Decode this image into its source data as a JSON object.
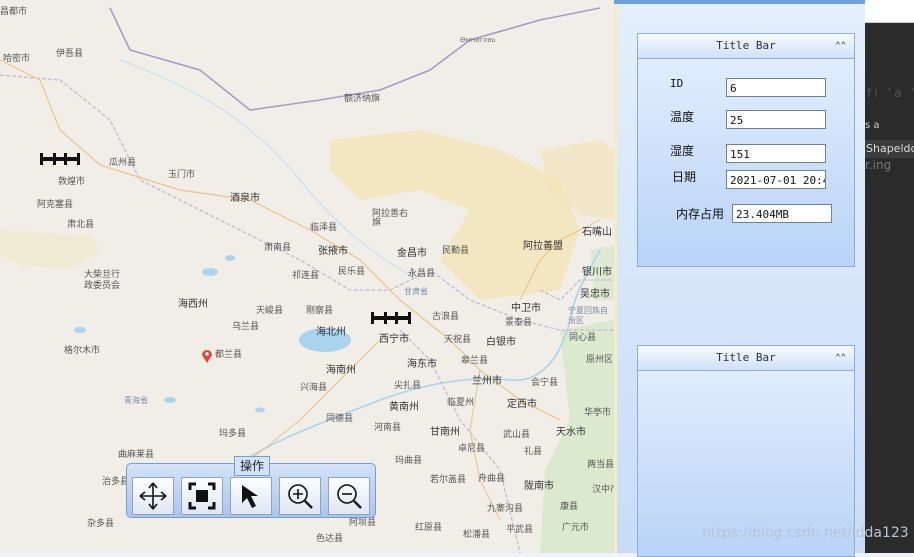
{
  "map": {
    "places": [
      {
        "id": "p01",
        "text": "哈密市",
        "cls": ""
      },
      {
        "id": "p02",
        "text": "伊吾县",
        "cls": ""
      },
      {
        "id": "p03",
        "text": "额济纳旗",
        "cls": ""
      },
      {
        "id": "p04",
        "text": "瓜州县",
        "cls": ""
      },
      {
        "id": "p05",
        "text": "玉门市",
        "cls": ""
      },
      {
        "id": "p06",
        "text": "敦煌市",
        "cls": ""
      },
      {
        "id": "p07",
        "text": "阿克塞县",
        "cls": ""
      },
      {
        "id": "p08",
        "text": "肃北县",
        "cls": ""
      },
      {
        "id": "p09",
        "text": "酒泉市",
        "cls": "big"
      },
      {
        "id": "p10",
        "text": "临泽县",
        "cls": ""
      },
      {
        "id": "p11",
        "text": "阿拉善右旗",
        "cls": ""
      },
      {
        "id": "p12",
        "text": "肃南县",
        "cls": ""
      },
      {
        "id": "p13",
        "text": "张掖市",
        "cls": "big"
      },
      {
        "id": "p14",
        "text": "金昌市",
        "cls": "big"
      },
      {
        "id": "p15",
        "text": "民勤县",
        "cls": ""
      },
      {
        "id": "p16",
        "text": "阿拉善盟",
        "cls": "big"
      },
      {
        "id": "p17",
        "text": "石嘴山",
        "cls": "big"
      },
      {
        "id": "p18",
        "text": "大柴旦行政委员会",
        "cls": ""
      },
      {
        "id": "p19",
        "text": "祁连县",
        "cls": ""
      },
      {
        "id": "p20",
        "text": "民乐县",
        "cls": ""
      },
      {
        "id": "p21",
        "text": "永昌县",
        "cls": ""
      },
      {
        "id": "p22",
        "text": "银川市",
        "cls": "big"
      },
      {
        "id": "p23",
        "text": "甘肃省",
        "cls": "prov"
      },
      {
        "id": "p24",
        "text": "吴忠市",
        "cls": "big"
      },
      {
        "id": "p25",
        "text": "海西州",
        "cls": "big"
      },
      {
        "id": "p26",
        "text": "天峻县",
        "cls": ""
      },
      {
        "id": "p27",
        "text": "刚察县",
        "cls": ""
      },
      {
        "id": "p28",
        "text": "中卫市",
        "cls": "big"
      },
      {
        "id": "p29",
        "text": "景泰县",
        "cls": ""
      },
      {
        "id": "p30",
        "text": "宁夏回族自治区",
        "cls": "prov"
      },
      {
        "id": "p31",
        "text": "乌兰县",
        "cls": ""
      },
      {
        "id": "p32",
        "text": "海北州",
        "cls": "big"
      },
      {
        "id": "p33",
        "text": "古浪县",
        "cls": ""
      },
      {
        "id": "p34",
        "text": "天祝县",
        "cls": ""
      },
      {
        "id": "p35",
        "text": "白银市",
        "cls": "big"
      },
      {
        "id": "p36",
        "text": "同心县",
        "cls": ""
      },
      {
        "id": "p37",
        "text": "格尔木市",
        "cls": ""
      },
      {
        "id": "p38",
        "text": "西宁市",
        "cls": "big"
      },
      {
        "id": "p39",
        "text": "都兰县",
        "cls": ""
      },
      {
        "id": "p40",
        "text": "海南州",
        "cls": "big"
      },
      {
        "id": "p41",
        "text": "海东市",
        "cls": "big"
      },
      {
        "id": "p42",
        "text": "皋兰县",
        "cls": ""
      },
      {
        "id": "p43",
        "text": "原州区",
        "cls": ""
      },
      {
        "id": "p44",
        "text": "兴海县",
        "cls": ""
      },
      {
        "id": "p45",
        "text": "尖扎县",
        "cls": ""
      },
      {
        "id": "p46",
        "text": "兰州市",
        "cls": "big"
      },
      {
        "id": "p47",
        "text": "会宁县",
        "cls": ""
      },
      {
        "id": "p48",
        "text": "青海省",
        "cls": "prov"
      },
      {
        "id": "p49",
        "text": "黄南州",
        "cls": "big"
      },
      {
        "id": "p50",
        "text": "临夏州",
        "cls": ""
      },
      {
        "id": "p51",
        "text": "定西市",
        "cls": "big"
      },
      {
        "id": "p52",
        "text": "华亭市",
        "cls": ""
      },
      {
        "id": "p53",
        "text": "同德县",
        "cls": ""
      },
      {
        "id": "p54",
        "text": "河南县",
        "cls": ""
      },
      {
        "id": "p55",
        "text": "甘南州",
        "cls": "big"
      },
      {
        "id": "p56",
        "text": "武山县",
        "cls": ""
      },
      {
        "id": "p57",
        "text": "天水市",
        "cls": "big"
      },
      {
        "id": "p58",
        "text": "玛多县",
        "cls": ""
      },
      {
        "id": "p59",
        "text": "曲麻莱县",
        "cls": ""
      },
      {
        "id": "p60",
        "text": "玛曲县",
        "cls": ""
      },
      {
        "id": "p61",
        "text": "卓尼县",
        "cls": ""
      },
      {
        "id": "p62",
        "text": "礼县",
        "cls": ""
      },
      {
        "id": "p63",
        "text": "两当县",
        "cls": ""
      },
      {
        "id": "p64",
        "text": "治多县",
        "cls": ""
      },
      {
        "id": "p65",
        "text": "若尔盖县",
        "cls": ""
      },
      {
        "id": "p66",
        "text": "舟曲县",
        "cls": ""
      },
      {
        "id": "p67",
        "text": "陇南市",
        "cls": "big"
      },
      {
        "id": "p68",
        "text": "汉中市",
        "cls": ""
      },
      {
        "id": "p69",
        "text": "杂多县",
        "cls": ""
      },
      {
        "id": "p70",
        "text": "九寨沟县",
        "cls": ""
      },
      {
        "id": "p71",
        "text": "康县",
        "cls": ""
      },
      {
        "id": "p72",
        "text": "阿坝县",
        "cls": ""
      },
      {
        "id": "p73",
        "text": "红原县",
        "cls": ""
      },
      {
        "id": "p74",
        "text": "平武县",
        "cls": ""
      },
      {
        "id": "p75",
        "text": "广元市",
        "cls": ""
      },
      {
        "id": "p76",
        "text": "色达县",
        "cls": ""
      },
      {
        "id": "p77",
        "text": "松潘县",
        "cls": ""
      },
      {
        "id": "p78",
        "text": "昌都市",
        "cls": ""
      },
      {
        "id": "p79",
        "text": "Өмнөговь",
        "cls": "mongol"
      }
    ]
  },
  "panel": {
    "pane1": {
      "title": "Title Bar",
      "collapse": "⌃⌃",
      "rows": [
        {
          "label": "ID",
          "value": "6"
        },
        {
          "label": "温度",
          "value": "25"
        },
        {
          "label": "湿度",
          "value": "151"
        },
        {
          "label": "日期",
          "value": "2021-07-01 20:45"
        },
        {
          "label": "内存占用",
          "value": "23.404MB"
        }
      ]
    },
    "pane2": {
      "title": "Title Bar",
      "collapse": "⌃⌃"
    }
  },
  "toolbar": {
    "title": "操作",
    "buttons": [
      {
        "name": "pan-tool-button",
        "icon": "move-arrows-icon"
      },
      {
        "name": "full-extent-button",
        "icon": "full-extent-icon"
      },
      {
        "name": "select-tool-button",
        "icon": "arrow-cursor-icon"
      },
      {
        "name": "zoom-in-button",
        "icon": "zoom-in-icon"
      },
      {
        "name": "zoom-out-button",
        "icon": "zoom-out-icon"
      }
    ]
  },
  "ide": {
    "tab_text": "s a",
    "shape_text": "Shapeldc",
    "faint_text": "fi ’a ’a",
    "faint_text2": "r.ing"
  },
  "watermark": "https://blog.csdn.net/ldda123",
  "colors": {
    "accent": "#6fa0dc",
    "panel_bg": "#c9dcf7",
    "ide_bg": "#2b2b2b",
    "pin": "#e8413c"
  }
}
